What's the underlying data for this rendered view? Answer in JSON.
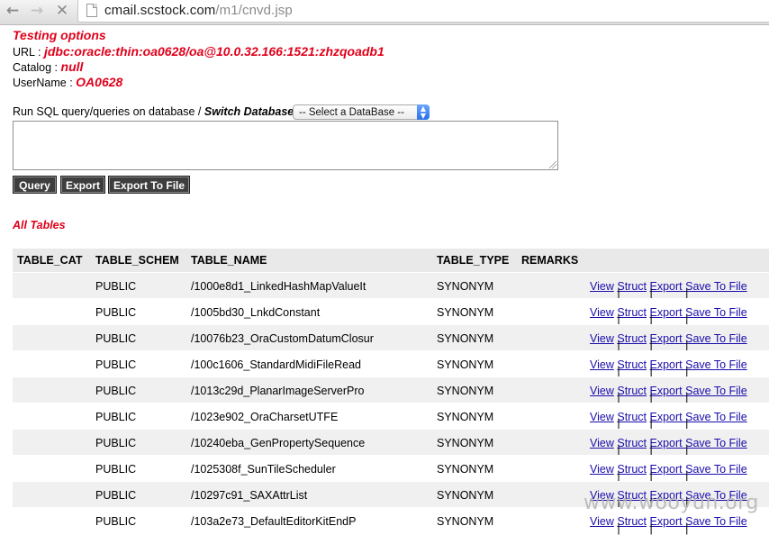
{
  "browser": {
    "back_glyph": "←",
    "forward_glyph": "→",
    "stop_glyph": "✕",
    "url_host": "cmail.scstock.com",
    "url_path": "/m1/cnvd.jsp"
  },
  "info": {
    "title": "Testing options",
    "url_label": "URL :",
    "url_value": "jdbc:oracle:thin:oa0628/oa@10.0.32.166:1521:zhzqoadb1",
    "catalog_label": "Catalog :",
    "catalog_value": "null",
    "username_label": "UserName :",
    "username_value": "OA0628"
  },
  "query": {
    "label": "Run SQL query/queries on database /",
    "switch_label": "Switch Database :",
    "select_value": "-- Select a DataBase --",
    "textarea_value": "",
    "buttons": {
      "query": "Query",
      "export": "Export",
      "export_file": "Export To File"
    }
  },
  "tables": {
    "heading": "All Tables",
    "columns": [
      "TABLE_CAT",
      "TABLE_SCHEM",
      "TABLE_NAME",
      "TABLE_TYPE",
      "REMARKS"
    ],
    "actions": [
      "View",
      "Struct",
      "Export ",
      "Save To File"
    ],
    "rows": [
      {
        "cat": "",
        "schem": "PUBLIC",
        "name": "/1000e8d1_LinkedHashMapValueIt",
        "type": "SYNONYM",
        "remarks": ""
      },
      {
        "cat": "",
        "schem": "PUBLIC",
        "name": "/1005bd30_LnkdConstant",
        "type": "SYNONYM",
        "remarks": ""
      },
      {
        "cat": "",
        "schem": "PUBLIC",
        "name": "/10076b23_OraCustomDatumClosur",
        "type": "SYNONYM",
        "remarks": ""
      },
      {
        "cat": "",
        "schem": "PUBLIC",
        "name": "/100c1606_StandardMidiFileRead",
        "type": "SYNONYM",
        "remarks": ""
      },
      {
        "cat": "",
        "schem": "PUBLIC",
        "name": "/1013c29d_PlanarImageServerPro",
        "type": "SYNONYM",
        "remarks": ""
      },
      {
        "cat": "",
        "schem": "PUBLIC",
        "name": "/1023e902_OraCharsetUTFE",
        "type": "SYNONYM",
        "remarks": ""
      },
      {
        "cat": "",
        "schem": "PUBLIC",
        "name": "/10240eba_GenPropertySequence",
        "type": "SYNONYM",
        "remarks": ""
      },
      {
        "cat": "",
        "schem": "PUBLIC",
        "name": "/1025308f_SunTileScheduler",
        "type": "SYNONYM",
        "remarks": ""
      },
      {
        "cat": "",
        "schem": "PUBLIC",
        "name": "/10297c91_SAXAttrList",
        "type": "SYNONYM",
        "remarks": ""
      },
      {
        "cat": "",
        "schem": "PUBLIC",
        "name": "/103a2e73_DefaultEditorKitEndP",
        "type": "SYNONYM",
        "remarks": ""
      }
    ]
  },
  "watermark": "www.wooyun.org"
}
